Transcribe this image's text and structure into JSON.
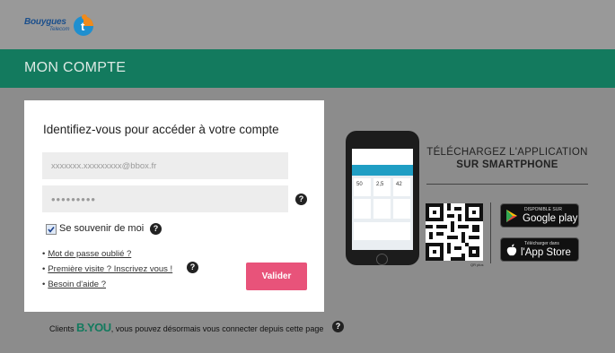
{
  "brand": {
    "logo_text": "Bouygues",
    "logo_sub": "Telecom",
    "colors": {
      "green": "#137a5e",
      "pink": "#e8537a",
      "navy": "#1b4f8c"
    }
  },
  "header": {
    "title": "MON COMPTE"
  },
  "login": {
    "heading": "Identifiez-vous pour accéder à votre compte",
    "email_value": "xxxxxxx.xxxxxxxxx@bbox.fr",
    "password_mask": "•••••••••",
    "remember_label": "Se souvenir de moi",
    "remember_checked": true,
    "links": [
      {
        "bullet": "•",
        "label": "Mot de passe oublié ?"
      },
      {
        "bullet": "•",
        "label": "Première visite ? Inscrivez vous !"
      },
      {
        "bullet": "•",
        "label": "Besoin d'aide ?"
      }
    ],
    "submit_label": "Valider",
    "help_glyph": "?"
  },
  "footer": {
    "prefix": "Clients ",
    "brand": "B.YOU",
    "suffix": ", vous pouvez désormais vous connecter depuis cette page"
  },
  "download": {
    "title": "TÉLÉCHARGEZ L'APPLICATION",
    "subtitle": "SUR SMARTPHONE",
    "qr_caption": "QR plus",
    "play": {
      "small": "DISPONIBLE SUR",
      "big": "Google play",
      "icon": "play-icon"
    },
    "apple": {
      "small": "Télécharger dans",
      "big": "l'App Store",
      "icon": "apple-icon"
    }
  },
  "phone": {
    "tiles": [
      "50",
      "2,5",
      "42"
    ]
  }
}
